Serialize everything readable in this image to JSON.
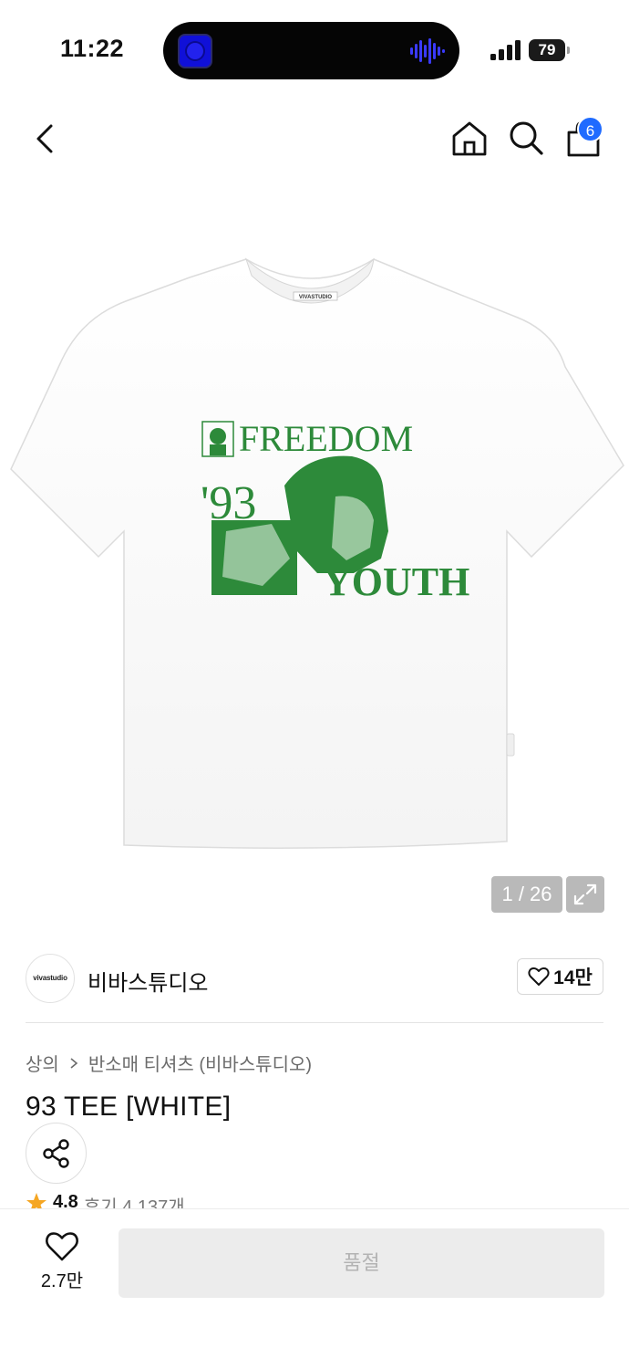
{
  "status_bar": {
    "time": "11:22",
    "battery": "79"
  },
  "nav": {
    "cart_badge": "6"
  },
  "hero": {
    "page_indicator": "1 / 26",
    "tee_label": "VIVASTUDIO",
    "print_top": "FREEDOM",
    "print_year": "'93",
    "print_bottom": "YOUTH",
    "print_color": "#2d8a3a"
  },
  "brand": {
    "logo_text": "vivastudio",
    "name": "비바스튜디오",
    "like_count": "14만"
  },
  "breadcrumb": {
    "category": "상의",
    "subcategory": "반소매 티셔츠 (비바스튜디오)"
  },
  "product": {
    "title": "93 TEE [WHITE]",
    "rating": "4.8",
    "review_label": "후기 4,137개",
    "star_color": "#f5a623"
  },
  "bottom": {
    "wish_count": "2.7만",
    "soldout_label": "품절"
  }
}
